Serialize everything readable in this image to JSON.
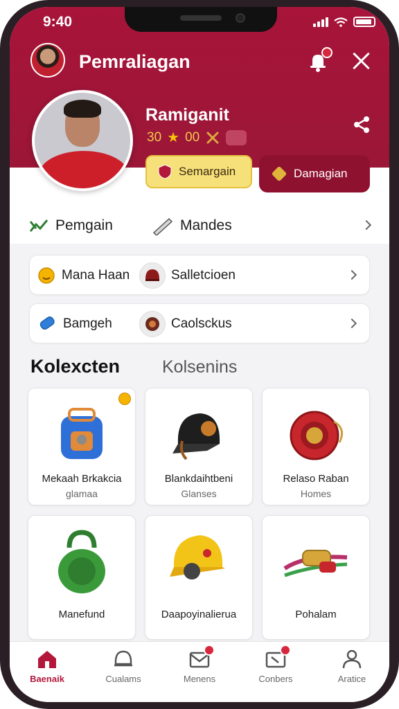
{
  "status_bar": {
    "time": "9:40"
  },
  "header": {
    "title": "Pemraliagan"
  },
  "profile": {
    "name": "Ramiganit",
    "stat_a": "30",
    "stat_b": "00"
  },
  "actions": {
    "primary_label": "Semargain",
    "secondary_label": "Damagian"
  },
  "quick_links": {
    "left_label": "Pemgain",
    "right_label": "Mandes"
  },
  "rows": [
    {
      "left_label": "Mana Haan",
      "right_label": "Salletcioen"
    },
    {
      "left_label": "Bamgeh",
      "right_label": "Caolsckus"
    }
  ],
  "collection": {
    "tab_active": "Kolexcten",
    "tab_inactive": "Kolsenins",
    "items": [
      {
        "name": "Mekaah Brkakcia",
        "sub": "glamaa"
      },
      {
        "name": "Blankdaihtbeni",
        "sub": "Glanses"
      },
      {
        "name": "Relaso Raban",
        "sub": "Homes"
      },
      {
        "name": "Manefund",
        "sub": ""
      },
      {
        "name": "Daapoyinalierua",
        "sub": ""
      },
      {
        "name": "Pohalam",
        "sub": ""
      }
    ]
  },
  "nav": [
    {
      "label": "Baenaik",
      "icon": "home-icon"
    },
    {
      "label": "Cualams",
      "icon": "helmet-icon"
    },
    {
      "label": "Menens",
      "icon": "mail-icon"
    },
    {
      "label": "Conbers",
      "icon": "inbox-icon"
    },
    {
      "label": "Aratice",
      "icon": "user-icon"
    }
  ],
  "colors": {
    "brand": "#a8143a",
    "accent_yellow": "#f6e07a",
    "active_nav": "#b3183b"
  }
}
